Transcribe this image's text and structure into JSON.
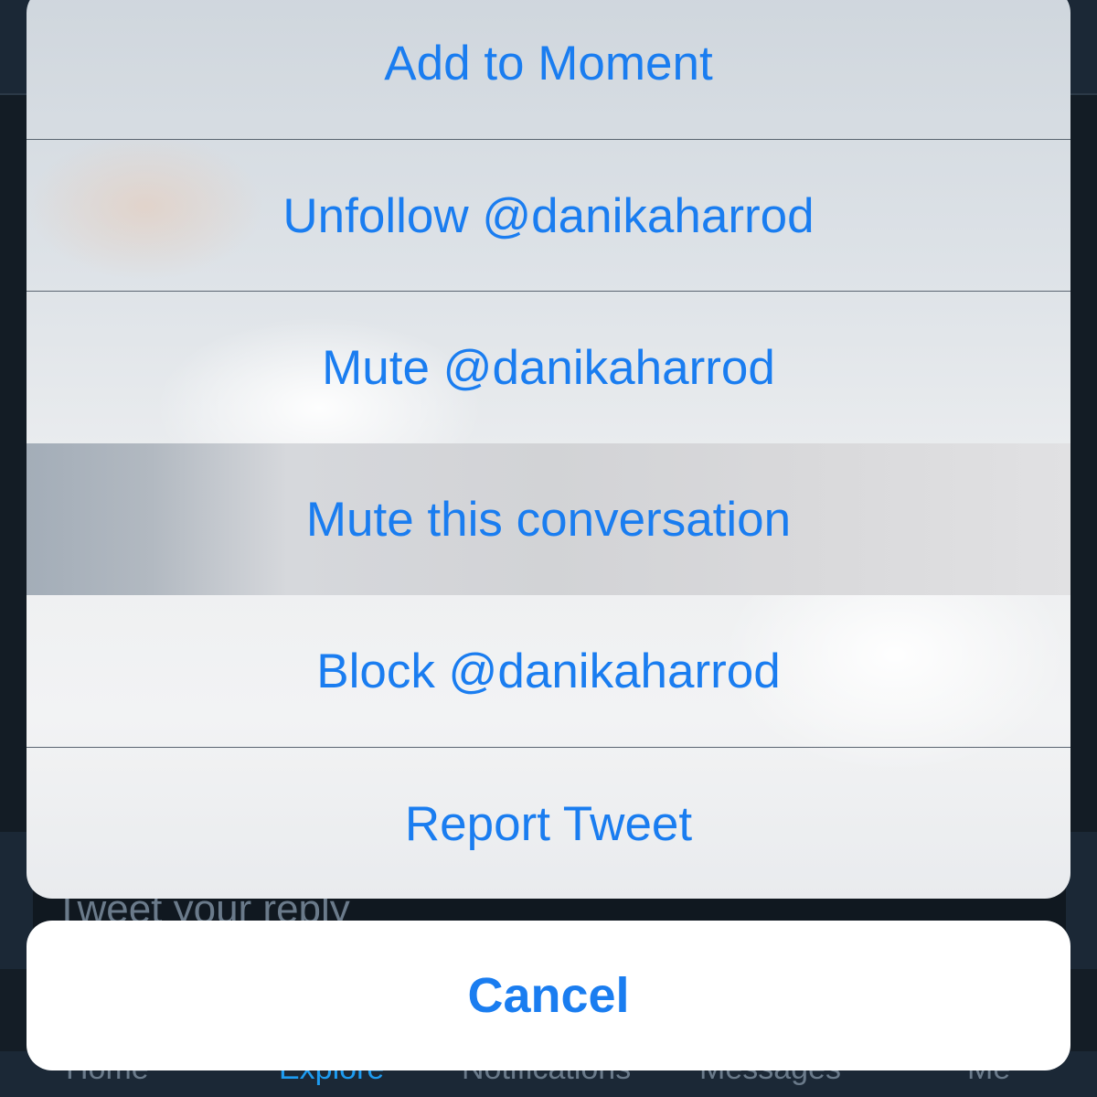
{
  "action_sheet": {
    "items": [
      {
        "label": "Add to Moment"
      },
      {
        "label": "Unfollow @danikaharrod"
      },
      {
        "label": "Mute @danikaharrod"
      },
      {
        "label": "Mute this conversation"
      },
      {
        "label": "Block @danikaharrod"
      },
      {
        "label": "Report Tweet"
      }
    ],
    "highlighted_index": 3,
    "cancel_label": "Cancel",
    "accent_color": "#1a7df0"
  },
  "background": {
    "reply_placeholder": "Tweet your reply",
    "tabs": [
      {
        "label": "Home"
      },
      {
        "label": "Explore"
      },
      {
        "label": "Notifications"
      },
      {
        "label": "Messages"
      },
      {
        "label": "Me"
      }
    ],
    "active_tab_index": 1
  }
}
